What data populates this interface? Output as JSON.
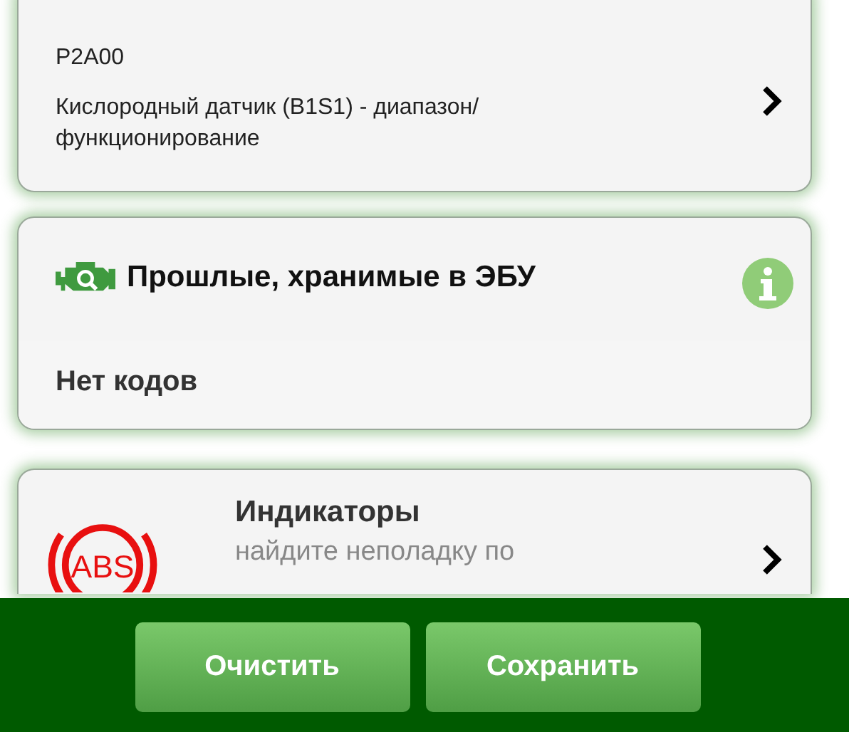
{
  "fault_card": {
    "code": "P2A00",
    "description": "Кислородный датчик (B1S1) - диапазон/ функционирование"
  },
  "stored_card": {
    "title": "Прошлые, хранимые в ЭБУ",
    "message": "Нет кодов"
  },
  "indicators_card": {
    "icon_text": "ABS",
    "title": "Индикаторы",
    "subtitle": "найдите неполадку по"
  },
  "buttons": [
    {
      "label": "Очистить"
    },
    {
      "label": "Сохранить"
    }
  ]
}
